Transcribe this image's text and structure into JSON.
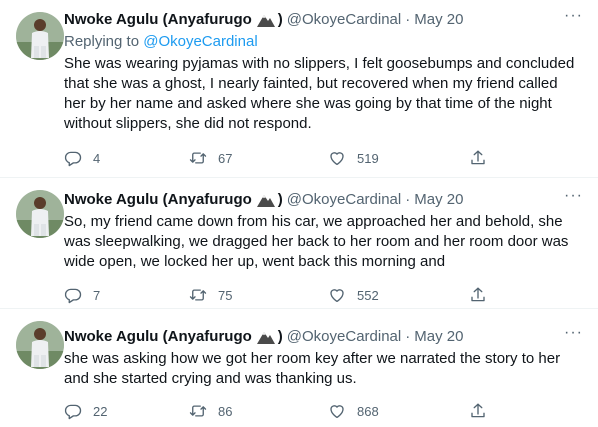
{
  "tweets": [
    {
      "name": "Nwoke Agulu (Anyafurugo",
      "name_close": ")",
      "handle": "@OkoyeCardinal",
      "sep": "·",
      "date": "May 20",
      "replying_prefix": "Replying to",
      "replying_handle": "@OkoyeCardinal",
      "text": "She was wearing pyjamas with no slippers, I felt goosebumps and concluded that she was a ghost, I nearly fainted, but recovered when my friend called her by her name and asked where she was going by that time of the night without slippers, she did not respond.",
      "replies": "4",
      "retweets": "67",
      "likes": "519"
    },
    {
      "name": "Nwoke Agulu (Anyafurugo",
      "name_close": ")",
      "handle": "@OkoyeCardinal",
      "sep": "·",
      "date": "May 20",
      "text": "So, my friend came down from his car, we approached her and behold, she was sleepwalking, we dragged her back to her room and her room door was wide open, we locked her up, went back this morning and",
      "replies": "7",
      "retweets": "75",
      "likes": "552"
    },
    {
      "name": "Nwoke Agulu (Anyafurugo",
      "name_close": ")",
      "handle": "@OkoyeCardinal",
      "sep": "·",
      "date": "May 20",
      "text": "she was asking how we got her room key after we narrated the story to her and she started crying and was thanking us.",
      "replies": "22",
      "retweets": "86",
      "likes": "868"
    }
  ],
  "icons": {
    "reply": "reply-icon",
    "retweet": "retweet-icon",
    "like": "heart-icon",
    "share": "share-icon",
    "more": "more-icon",
    "badge": "mountain-emoji-icon"
  },
  "colors": {
    "text": "#0f1419",
    "secondary": "#536471",
    "link": "#1d9bf0",
    "divider": "#eff3f4"
  }
}
